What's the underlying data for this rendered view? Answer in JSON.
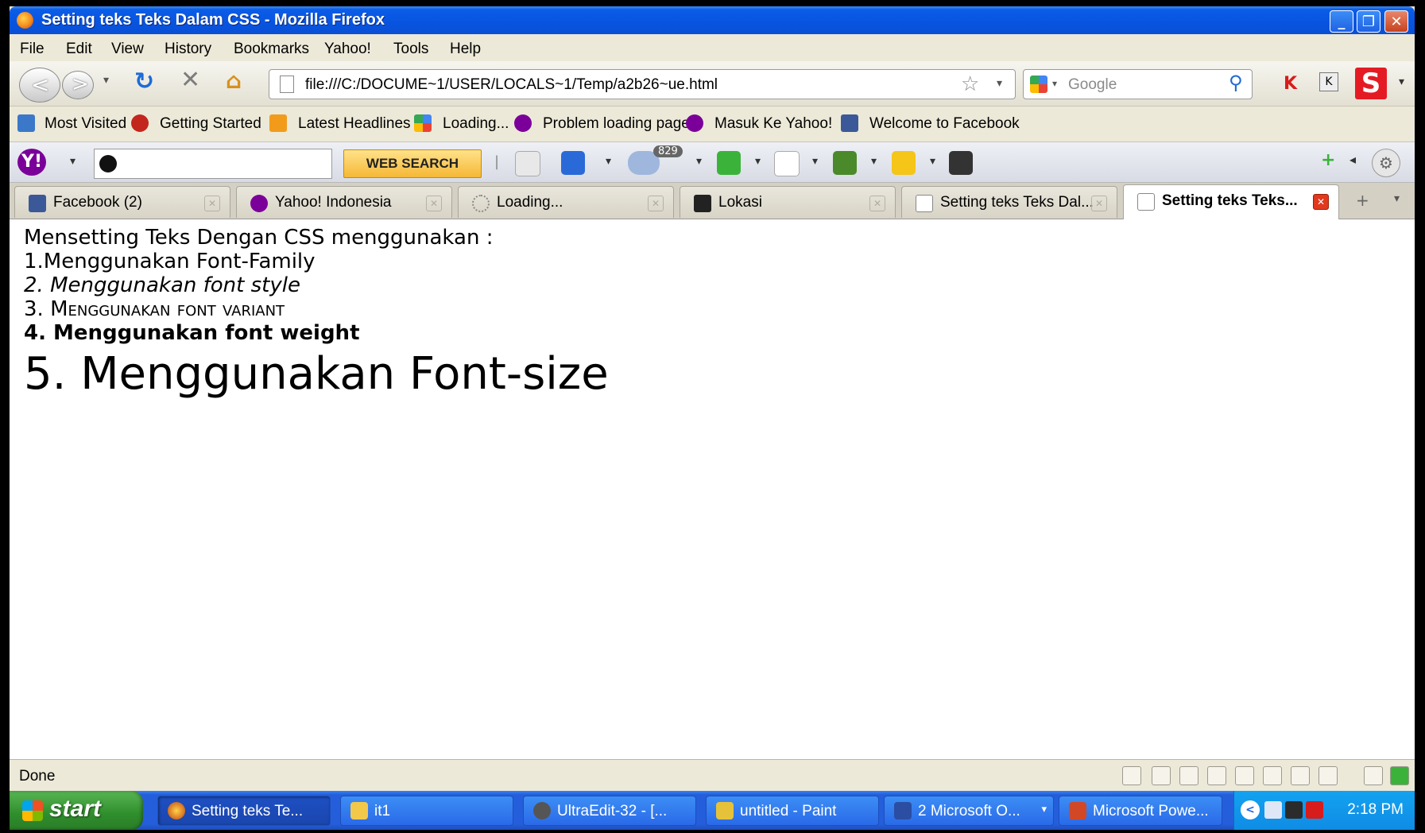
{
  "window": {
    "title": "Setting teks Teks Dalam CSS - Mozilla Firefox"
  },
  "menu": [
    "File",
    "Edit",
    "View",
    "History",
    "Bookmarks",
    "Yahoo!",
    "Tools",
    "Help"
  ],
  "navbar": {
    "url": "file:///C:/DOCUME~1/USER/LOCALS~1/Temp/a2b26~ue.html",
    "search_placeholder": "Google"
  },
  "bookmarks": [
    "Most Visited",
    "Getting Started",
    "Latest Headlines",
    "Loading...",
    "Problem loading page",
    "Masuk Ke Yahoo!",
    "Welcome to Facebook"
  ],
  "yahoo_toolbar": {
    "search_button": "WEB SEARCH",
    "weather_badge": "829"
  },
  "tabs": [
    {
      "label": "Facebook (2)",
      "active": false
    },
    {
      "label": "Yahoo! Indonesia",
      "active": false
    },
    {
      "label": "Loading...",
      "active": false
    },
    {
      "label": "Lokasi",
      "active": false
    },
    {
      "label": "Setting teks Teks Dal...",
      "active": false
    },
    {
      "label": "Setting teks Teks...",
      "active": true
    }
  ],
  "content": {
    "intro": "Mensetting Teks Dengan CSS menggunakan :",
    "item1": "1.Menggunakan Font-Family",
    "item2": "2. Menggunakan font style",
    "item3": "3. Menggunakan font variant",
    "item4": "4. Menggunakan font weight",
    "item5": "5. Menggunakan Font-size"
  },
  "status": {
    "text": "Done"
  },
  "taskbar": {
    "start": "start",
    "items": [
      {
        "label": "Setting teks Te...",
        "active": true
      },
      {
        "label": "it1",
        "active": false
      },
      {
        "label": "UltraEdit-32 - [...",
        "active": false
      },
      {
        "label": "untitled - Paint",
        "active": false
      },
      {
        "label": "2 Microsoft O...",
        "active": false
      },
      {
        "label": "Microsoft Powe...",
        "active": false
      }
    ],
    "clock": "2:18 PM"
  }
}
